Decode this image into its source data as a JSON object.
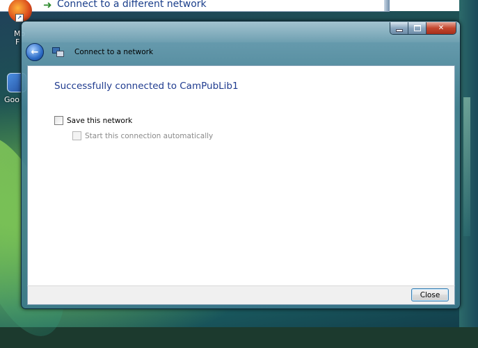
{
  "background_popup": {
    "text": "Connect to a different network"
  },
  "desktop_icons": [
    {
      "label_line1": "Mo",
      "label_line2": "F"
    },
    {
      "label": "Goo"
    }
  ],
  "window": {
    "nav_title": "Connect to a network",
    "success_message": "Successfully connected to CamPubLib1",
    "save_network_label": "Save this network",
    "save_network_checked": false,
    "auto_start_label": "Start this connection automatically",
    "auto_start_checked": false,
    "auto_start_enabled": false,
    "close_button_label": "Close"
  },
  "icons": [
    "back-arrow-icon",
    "network-icon",
    "minimize-icon",
    "maximize-icon",
    "close-icon",
    "firefox-icon",
    "shortcut-icon"
  ],
  "colors": {
    "success_text": "#1f3b8f",
    "close_caption": "#c4472e"
  }
}
